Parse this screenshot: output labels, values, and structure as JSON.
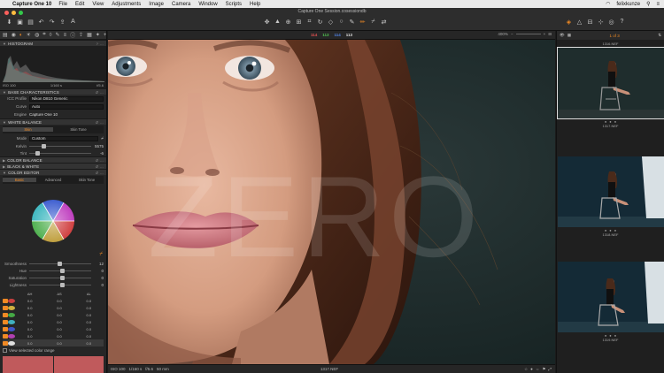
{
  "menubar": {
    "app": "Capture One 10",
    "items": [
      "File",
      "Edit",
      "View",
      "Adjustments",
      "Image",
      "Camera",
      "Window",
      "Scripts",
      "Help"
    ],
    "user": "felixkunze"
  },
  "window": {
    "title": "Capture One Session.cosessiondb"
  },
  "left_panel": {
    "histogram_title": "HISTOGRAM",
    "hist_readout": {
      "iso": "ISO 100",
      "shutter": "1/160 s",
      "aperture": "f/5.6"
    },
    "base_char_title": "BASE CHARACTERISTICS",
    "icc_label": "ICC Profile",
    "icc_value": "Nikon D810 Generic",
    "curve_label": "Curve",
    "curve_value": "Auto",
    "engine_label": "Engine",
    "engine_value": "Capture One 10",
    "wb_title": "WHITE BALANCE",
    "wb_tabs": [
      "Skin",
      "Skin Tone"
    ],
    "mode_label": "Mode",
    "mode_value": "Custom",
    "kelvin_label": "Kelvin",
    "kelvin_value": "5575",
    "tint_label": "Tint",
    "tint_value": "-6",
    "color_balance_title": "COLOR BALANCE",
    "bw_title": "BLACK & WHITE",
    "color_editor_title": "COLOR EDITOR",
    "ce_tabs": [
      "Basic",
      "Advanced",
      "Skin Tone"
    ],
    "sliders": [
      {
        "label": "Smoothness",
        "value": "12"
      },
      {
        "label": "Hue",
        "value": "0"
      },
      {
        "label": "Saturation",
        "value": "0"
      },
      {
        "label": "Lightness",
        "value": "0"
      }
    ],
    "cr_headers": [
      "ΔH",
      "ΔS",
      "ΔL"
    ],
    "cr_rows": [
      {
        "color": "#c94040",
        "h": "0.0",
        "s": "0.0",
        "l": "0.0"
      },
      {
        "color": "#d0b040",
        "h": "0.0",
        "s": "0.0",
        "l": "0.0"
      },
      {
        "color": "#45a845",
        "h": "0.0",
        "s": "0.0",
        "l": "0.0"
      },
      {
        "color": "#40b0c0",
        "h": "0.0",
        "s": "0.0",
        "l": "0.0"
      },
      {
        "color": "#4055c8",
        "h": "0.0",
        "s": "0.0",
        "l": "0.0"
      },
      {
        "color": "#b040b0",
        "h": "0.0",
        "s": "0.0",
        "l": "0.0"
      },
      {
        "color": "#e0e0e0",
        "h": "0.0",
        "s": "0.0",
        "l": "0.0"
      }
    ],
    "view_selected": "View selected color range"
  },
  "viewer": {
    "readout": {
      "r": "114",
      "g": "113",
      "b": "114",
      "l": "113"
    },
    "zoom": "400%",
    "watermark": "ZERO",
    "bottom_info": {
      "iso": "ISO 100",
      "shutter": "1/160 s",
      "aperture": "f/5.6",
      "focal": "50 mm"
    },
    "filename": "1317.NEF"
  },
  "browser": {
    "counter": "1 of 3",
    "thumbs": [
      {
        "name": "1316.NEF"
      },
      {
        "name": "1317.NEF"
      },
      {
        "name": "1318.NEF"
      },
      {
        "name": "1319.NEF"
      }
    ]
  },
  "colors": {
    "accent": "#f08a24",
    "panel": "#262626",
    "swatch": "#c05a5c",
    "photo_bg": "#1d2b2b"
  }
}
